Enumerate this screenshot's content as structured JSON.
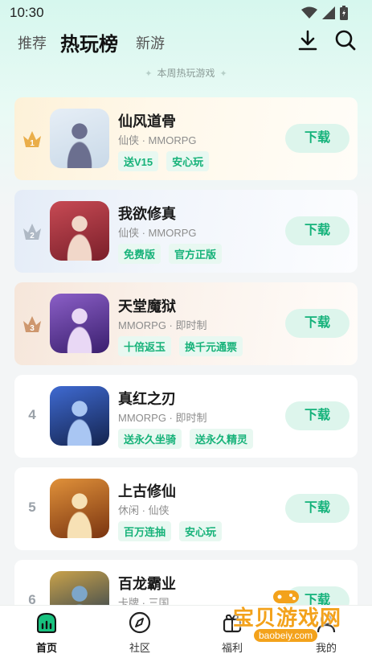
{
  "status": {
    "time": "10:30"
  },
  "header": {
    "tabs": [
      "推荐",
      "热玩榜",
      "新游"
    ],
    "active_tab": "热玩榜",
    "subtitle": "本周热玩游戏"
  },
  "games": [
    {
      "rank": "1",
      "name": "仙风道骨",
      "meta": "仙侠 · MMORPG",
      "tags": [
        "送V15",
        "安心玩"
      ],
      "button": "下载",
      "icon_colors": [
        "#c9d9e8",
        "#e6eef6",
        "#6b6f8f"
      ]
    },
    {
      "rank": "2",
      "name": "我欲修真",
      "meta": "仙侠 · MMORPG",
      "tags": [
        "免费版",
        "官方正版"
      ],
      "button": "下载",
      "icon_colors": [
        "#7a1f2a",
        "#c74a54",
        "#f1d7c9"
      ]
    },
    {
      "rank": "3",
      "name": "天堂魔狱",
      "meta": "MMORPG · 即时制",
      "tags": [
        "十倍返玉",
        "换千元通票"
      ],
      "button": "下载",
      "icon_colors": [
        "#3a1f6e",
        "#8b5fc7",
        "#e9d8f5"
      ]
    },
    {
      "rank": "4",
      "name": "真红之刃",
      "meta": "MMORPG · 即时制",
      "tags": [
        "送永久坐骑",
        "送永久精灵"
      ],
      "button": "下载",
      "icon_colors": [
        "#14244f",
        "#3f6ad1",
        "#a9c6f3"
      ]
    },
    {
      "rank": "5",
      "name": "上古修仙",
      "meta": "休闲 · 仙侠",
      "tags": [
        "百万连抽",
        "安心玩"
      ],
      "button": "下载",
      "icon_colors": [
        "#7a3410",
        "#e0913a",
        "#f7e1b5"
      ]
    },
    {
      "rank": "6",
      "name": "百龙霸业",
      "meta": "卡牌 · 三国",
      "tags": [],
      "button": "下载",
      "icon_colors": [
        "#1d3550",
        "#c9a24a",
        "#7da6c9"
      ]
    }
  ],
  "nav": {
    "items": [
      {
        "label": "首页",
        "icon": "home-icon"
      },
      {
        "label": "社区",
        "icon": "compass-icon"
      },
      {
        "label": "福利",
        "icon": "gift-icon"
      },
      {
        "label": "我的",
        "icon": "user-icon"
      }
    ],
    "active": "首页"
  },
  "watermark": {
    "text": "宝贝游戏网",
    "url": "baobeiy.com"
  },
  "colors": {
    "accent": "#16b279",
    "accent_bg": "#ddf5ec",
    "gold": "#e8a63a",
    "silver": "#a8b2bf",
    "bronze": "#c98e62"
  }
}
